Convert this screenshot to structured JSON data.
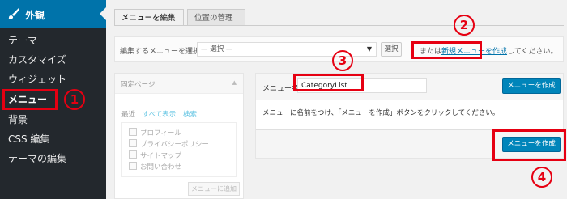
{
  "sidebar": {
    "header": "外観",
    "items": [
      {
        "label": "テーマ"
      },
      {
        "label": "カスタマイズ"
      },
      {
        "label": "ウィジェット"
      },
      {
        "label": "メニュー"
      },
      {
        "label": "背景"
      },
      {
        "label": "CSS 編集"
      },
      {
        "label": "テーマの編集"
      }
    ]
  },
  "tabs": {
    "edit": "メニューを編集",
    "locations": "位置の管理"
  },
  "select_bar": {
    "label": "編集するメニューを選択:",
    "dropdown_value": "— 選択 —",
    "select_button": "選択",
    "or_text": "または",
    "create_link": "新規メニューを作成",
    "after_text": "してください。"
  },
  "left_panel": {
    "title": "固定ページ",
    "tabs": [
      "最近",
      "すべて表示",
      "検索"
    ],
    "pages": [
      "プロフィール",
      "プライバシーポリシー",
      "サイトマップ",
      "お問い合わせ"
    ],
    "add_button": "メニューに追加"
  },
  "menu_editor": {
    "name_label": "メニュー名",
    "name_value": "CategoryList",
    "create_button": "メニューを作成",
    "hint": "メニューに名前をつけ、「メニューを作成」ボタンをクリックしてください。",
    "create_button_bottom": "メニューを作成"
  },
  "annotations": [
    "1",
    "2",
    "3",
    "4"
  ],
  "colors": {
    "sidebar_bg": "#23282d",
    "sidebar_active": "#0073aa",
    "primary_button": "#0085ba",
    "annotation_red": "#e60012"
  }
}
